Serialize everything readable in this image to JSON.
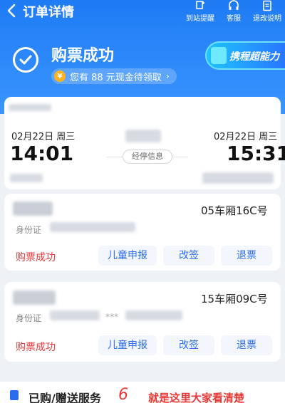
{
  "header": {
    "title": "订单详情",
    "tools": [
      {
        "label": "到站提醒",
        "icon": "bell-plus-icon"
      },
      {
        "label": "客服",
        "icon": "headset-icon"
      },
      {
        "label": "退改说明",
        "icon": "document-icon"
      }
    ]
  },
  "status": {
    "title": "购票成功",
    "cash_text": "您有 88 元现金待领取",
    "promo_text": "携程超能力"
  },
  "trip": {
    "depart_date": "02月22日",
    "depart_weekday": "周三",
    "depart_time": "14:01",
    "arrive_date": "02月22日",
    "arrive_weekday": "周三",
    "arrive_time": "15:31",
    "stops_label": "经停信息"
  },
  "passengers": [
    {
      "seat": "05车厢16C号",
      "id_label": "身份证",
      "status": "购票成功",
      "actions": [
        "儿童申报",
        "改签",
        "退票"
      ]
    },
    {
      "seat": "15车厢09C号",
      "id_label": "身份证",
      "id_mask": "***",
      "status": "购票成功",
      "actions": [
        "儿童申报",
        "改签",
        "退票"
      ]
    }
  ],
  "services": {
    "label": "已购/赠送服务",
    "note": "就是这里大家看清楚"
  },
  "colors": {
    "header_blue": "#1f7bf4",
    "accent_blue": "#2b6bef",
    "status_red": "#e5393b"
  }
}
